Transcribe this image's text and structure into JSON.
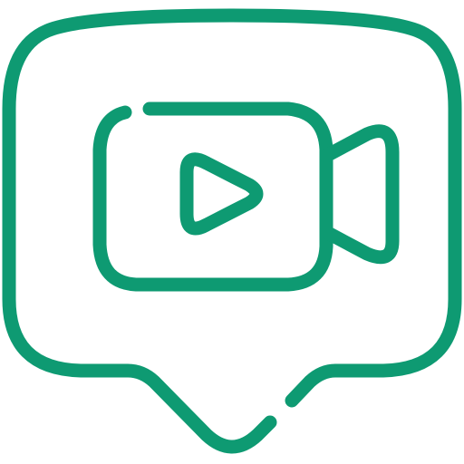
{
  "icon": {
    "name": "video-chat-bubble-icon",
    "style": "outline",
    "color": "#0E9A72",
    "background": "#ffffff"
  }
}
